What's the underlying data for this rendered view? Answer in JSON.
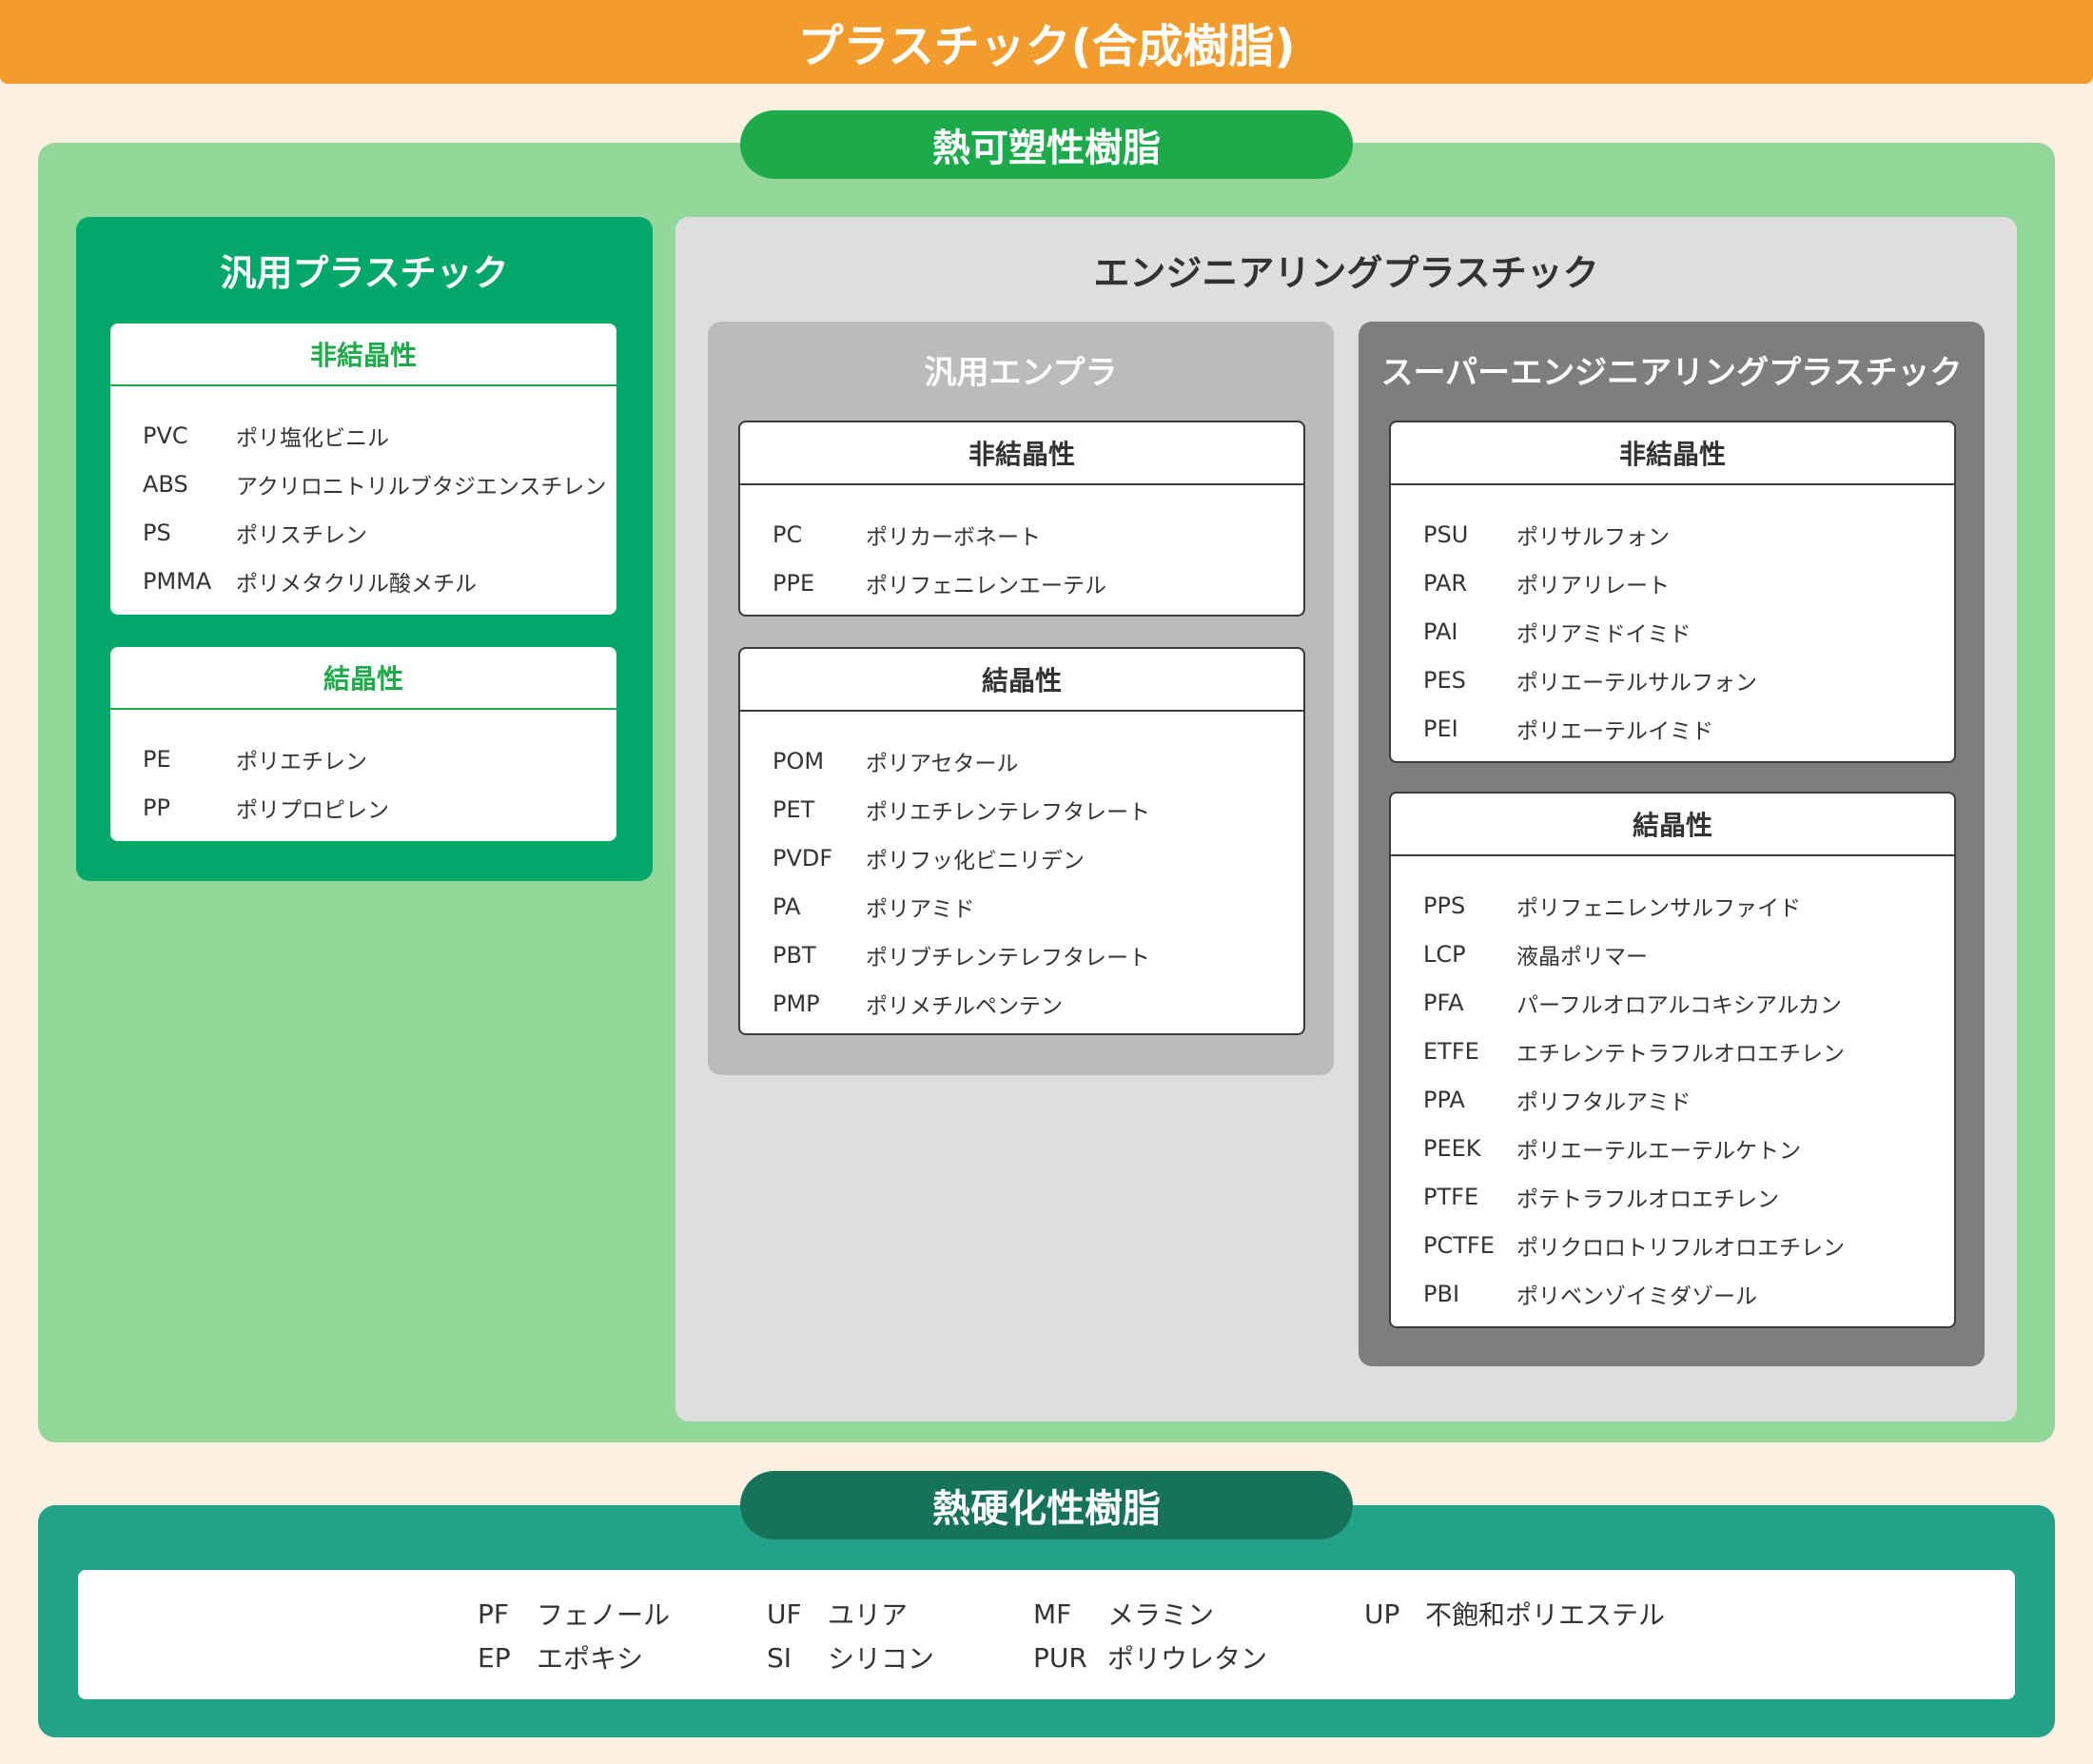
{
  "title": "プラスチック(合成樹脂)",
  "thermoplastic": {
    "label": "熱可塑性樹脂",
    "general": {
      "title": "汎用プラスチック",
      "amorphous": {
        "heading": "非結晶性",
        "items": [
          {
            "code": "PVC",
            "name": "ポリ塩化ビニル"
          },
          {
            "code": "ABS",
            "name": "アクリロニトリルブタジエンスチレン"
          },
          {
            "code": "PS",
            "name": "ポリスチレン"
          },
          {
            "code": "PMMA",
            "name": "ポリメタクリル酸メチル"
          }
        ]
      },
      "crystalline": {
        "heading": "結晶性",
        "items": [
          {
            "code": "PE",
            "name": "ポリエチレン"
          },
          {
            "code": "PP",
            "name": "ポリプロピレン"
          }
        ]
      }
    },
    "engineering": {
      "title": "エンジニアリングプラスチック",
      "general_enpla": {
        "title": "汎用エンプラ",
        "amorphous": {
          "heading": "非結晶性",
          "items": [
            {
              "code": "PC",
              "name": "ポリカーボネート"
            },
            {
              "code": "PPE",
              "name": "ポリフェニレンエーテル"
            }
          ]
        },
        "crystalline": {
          "heading": "結晶性",
          "items": [
            {
              "code": "POM",
              "name": "ポリアセタール"
            },
            {
              "code": "PET",
              "name": "ポリエチレンテレフタレート"
            },
            {
              "code": "PVDF",
              "name": "ポリフッ化ビニリデン"
            },
            {
              "code": "PA",
              "name": "ポリアミド"
            },
            {
              "code": "PBT",
              "name": "ポリブチレンテレフタレート"
            },
            {
              "code": "PMP",
              "name": "ポリメチルペンテン"
            }
          ]
        }
      },
      "super": {
        "title": "スーパーエンジニアリングプラスチック",
        "amorphous": {
          "heading": "非結晶性",
          "items": [
            {
              "code": "PSU",
              "name": "ポリサルフォン"
            },
            {
              "code": "PAR",
              "name": "ポリアリレート"
            },
            {
              "code": "PAI",
              "name": "ポリアミドイミド"
            },
            {
              "code": "PES",
              "name": "ポリエーテルサルフォン"
            },
            {
              "code": "PEI",
              "name": "ポリエーテルイミド"
            }
          ]
        },
        "crystalline": {
          "heading": "結晶性",
          "items": [
            {
              "code": "PPS",
              "name": "ポリフェニレンサルファイド"
            },
            {
              "code": "LCP",
              "name": "液晶ポリマー"
            },
            {
              "code": "PFA",
              "name": "パーフルオロアルコキシアルカン"
            },
            {
              "code": "ETFE",
              "name": "エチレンテトラフルオロエチレン"
            },
            {
              "code": "PPA",
              "name": "ポリフタルアミド"
            },
            {
              "code": "PEEK",
              "name": "ポリエーテルエーテルケトン"
            },
            {
              "code": "PTFE",
              "name": "ポテトラフルオロエチレン"
            },
            {
              "code": "PCTFE",
              "name": "ポリクロロトリフルオロエチレン"
            },
            {
              "code": "PBI",
              "name": "ポリベンゾイミダゾール"
            }
          ]
        }
      }
    }
  },
  "thermoset": {
    "label": "熱硬化性樹脂",
    "items": [
      {
        "code": "PF",
        "name": "フェノール"
      },
      {
        "code": "EP",
        "name": "エポキシ"
      },
      {
        "code": "UF",
        "name": "ユリア"
      },
      {
        "code": "SI",
        "name": "シリコン"
      },
      {
        "code": "MF",
        "name": "メラミン"
      },
      {
        "code": "PUR",
        "name": "ポリウレタン"
      },
      {
        "code": "UP",
        "name": "不飽和ポリエステル"
      }
    ]
  },
  "colors": {
    "banner": "#f19c2d",
    "thermoplastic_area": "#93d79b",
    "thermoplastic_pill": "#1caa4b",
    "general_panel": "#02a76a",
    "engineering_panel": "#dedede",
    "general_enpla_panel": "#bbbbbb",
    "super_panel": "#7e7e7e",
    "thermoset_area": "#22a286",
    "thermoset_pill": "#16735a"
  }
}
